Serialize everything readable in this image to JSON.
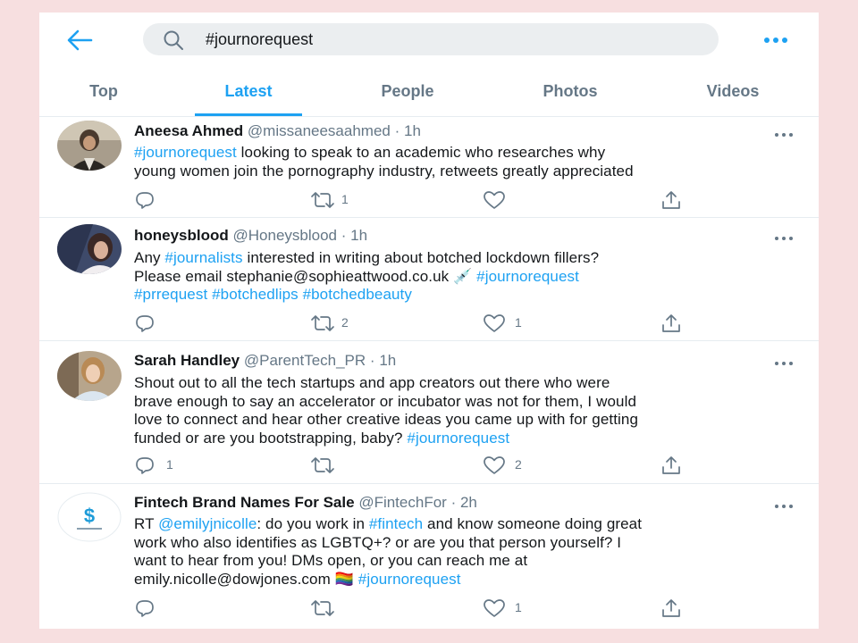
{
  "colors": {
    "accent": "#1da1f2",
    "muted": "#657786",
    "background": "#f7dfe0"
  },
  "search": {
    "query": "#journorequest",
    "icon": "search-icon"
  },
  "tabs": [
    {
      "label": "Top"
    },
    {
      "label": "Latest",
      "active": true
    },
    {
      "label": "People"
    },
    {
      "label": "Photos"
    },
    {
      "label": "Videos"
    }
  ],
  "tweets": [
    {
      "name": "Aneesa Ahmed",
      "handle": "@missaneesaahmed",
      "time": "1h",
      "lines": [
        [
          {
            "text": "#journorequest",
            "link": true
          },
          {
            "text": " looking to speak to an academic who researches why"
          }
        ],
        [
          {
            "text": "young women join the pornography industry, retweets greatly appreciated"
          }
        ]
      ],
      "replies": "",
      "retweets": "1",
      "likes": ""
    },
    {
      "name": "honeysblood",
      "handle": "@Honeysblood",
      "time": "1h",
      "lines": [
        [
          {
            "text": "Any "
          },
          {
            "text": "#journalists",
            "link": true
          },
          {
            "text": " interested in writing about botched lockdown fillers?"
          }
        ],
        [
          {
            "text": "Please email stephanie@sophieattwood.co.uk 💉 "
          },
          {
            "text": "#journorequest",
            "link": true
          }
        ],
        [
          {
            "text": "#prrequest #botchedlips #botchedbeauty",
            "link": true
          }
        ]
      ],
      "replies": "",
      "retweets": "2",
      "likes": "1"
    },
    {
      "name": "Sarah Handley",
      "handle": "@ParentTech_PR",
      "time": "1h",
      "lines": [
        [
          {
            "text": "Shout out to all the tech startups and app creators out there who were"
          }
        ],
        [
          {
            "text": "brave enough to say an accelerator or incubator was not for them, I would"
          }
        ],
        [
          {
            "text": "love to connect and hear other creative ideas you came up with for getting"
          }
        ],
        [
          {
            "text": "funded or are you bootstrapping, baby? "
          },
          {
            "text": "#journorequest",
            "link": true
          }
        ]
      ],
      "replies": "1",
      "retweets": "",
      "likes": "2"
    },
    {
      "name": "Fintech Brand Names For Sale",
      "handle": "@FintechFor",
      "time": "2h",
      "lines": [
        [
          {
            "text": "RT "
          },
          {
            "text": "@emilyjnicolle",
            "link": true
          },
          {
            "text": ": do you work in "
          },
          {
            "text": "#fintech",
            "link": true
          },
          {
            "text": " and know someone doing great"
          }
        ],
        [
          {
            "text": "work who also identifies as LGBTQ+? or are you that person yourself? I"
          }
        ],
        [
          {
            "text": "want to hear from you! DMs open, or you can reach me at"
          }
        ],
        [
          {
            "text": "emily.nicolle@dowjones.com 🏳️‍🌈 "
          },
          {
            "text": "#journorequest",
            "link": true
          }
        ]
      ],
      "replies": "",
      "retweets": "",
      "likes": "1"
    }
  ]
}
